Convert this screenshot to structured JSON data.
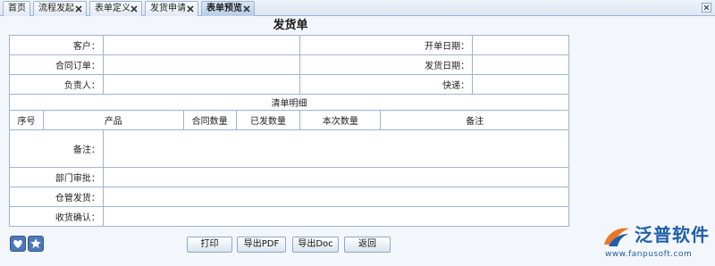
{
  "tabs": [
    {
      "label": "首页",
      "closable": false,
      "active": false
    },
    {
      "label": "流程发起",
      "closable": true,
      "active": false
    },
    {
      "label": "表单定义",
      "closable": true,
      "active": false
    },
    {
      "label": "发货申请",
      "closable": true,
      "active": false
    },
    {
      "label": "表单预览",
      "closable": true,
      "active": true
    }
  ],
  "form": {
    "title": "发货单",
    "fields": {
      "customer": "客户：",
      "open_date": "开单日期：",
      "contract_order": "合同订单：",
      "ship_date": "发货日期：",
      "owner": "负责人：",
      "express": "快递：",
      "detail_section": "清单明细",
      "remarks": "备注：",
      "dept_approval": "部门审批：",
      "warehouse_ship": "仓管发货：",
      "receipt_confirm": "收货确认："
    },
    "detail_columns": [
      "序号",
      "产品",
      "合同数量",
      "已发数量",
      "本次数量",
      "备注"
    ]
  },
  "buttons": {
    "print": "打印",
    "export_pdf": "导出PDF",
    "export_doc": "导出Doc",
    "back": "返回"
  },
  "logo": {
    "name": "泛普软件",
    "url": "www.fanpusoft.com"
  },
  "colors": {
    "border": "#9cb4d4",
    "brand_blue": "#1f5fa8",
    "logo_orange": "#e9772a"
  }
}
